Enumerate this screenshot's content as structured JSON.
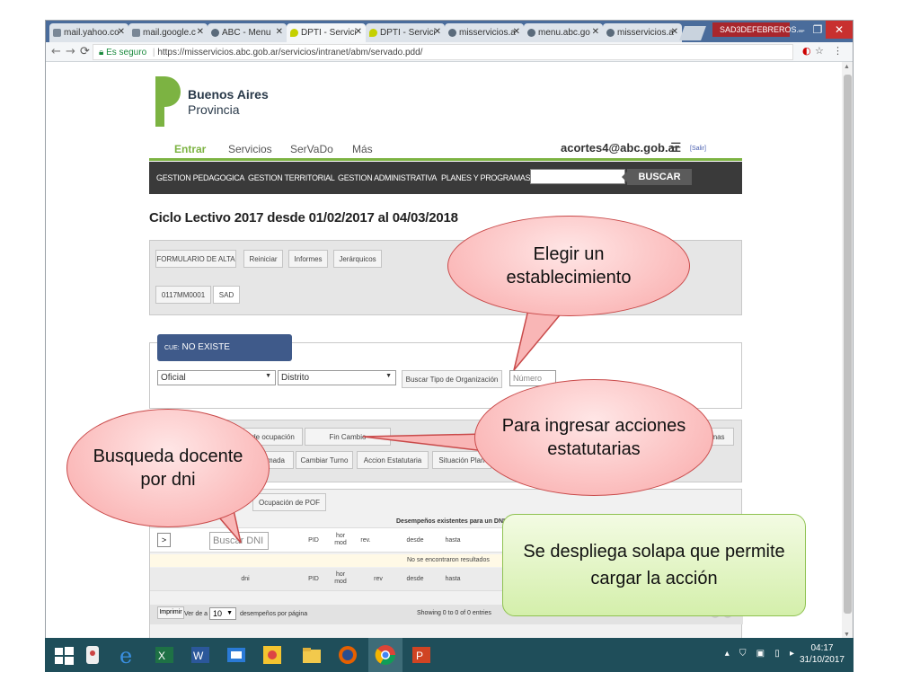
{
  "browser": {
    "tabs": [
      {
        "label": "mail.yahoo.co",
        "icon": "mail-icon"
      },
      {
        "label": "mail.google.c",
        "icon": "gmail-icon"
      },
      {
        "label": "ABC - Menu",
        "icon": "abc-icon"
      },
      {
        "label": "DPTI - Servici",
        "icon": "dpti-icon",
        "active": true
      },
      {
        "label": "DPTI - Servici",
        "icon": "dpti-icon"
      },
      {
        "label": "misservicios.a",
        "icon": "page-icon"
      },
      {
        "label": "menu.abc.go",
        "icon": "abc-icon"
      },
      {
        "label": "misservicios.a",
        "icon": "page-icon"
      }
    ],
    "profile_label": "SAD3DEFEBREROS...",
    "secure_label": "Es seguro",
    "url": "https://misservicios.abc.gob.ar/servicios/intranet/abm/servado.pdd/"
  },
  "site": {
    "logo_line1": "Buenos Aires",
    "logo_line2": "Provincia",
    "topnav": {
      "entrar": "Entrar",
      "servicios": "Servicios",
      "servado": "SerVaDo",
      "mas": "Más"
    },
    "user_email": "acortes4@abc.gob.ar",
    "salir": "[Salir]",
    "mainnav": [
      "GESTION PEDAGOGICA",
      "GESTION TERRITORIAL",
      "GESTION ADMINISTRATIVA",
      "PLANES Y PROGRAMAS"
    ],
    "buscar": "BUSCAR"
  },
  "page": {
    "title": "Ciclo Lectivo 2017 desde 01/02/2017 al 04/03/2018",
    "panel1_buttons": [
      "FORMULARIO DE ALTA",
      "Reiniciar",
      "Informes",
      "Jerárquicos"
    ],
    "panel1_row2": [
      "0117MM0001",
      "SAD"
    ],
    "cue_prefix": "CUE:",
    "cue_value": "NO EXISTE",
    "select_oficial": "Oficial",
    "select_distrito": "Distrito",
    "buscar_tipo": "Buscar Tipo de Organización",
    "numero_placeholder": "Número",
    "panel3_row1": [
      "de ocupación",
      "Fin Cambio"
    ],
    "panel3_row1_end": "mas",
    "panel3_row2": [
      "mada",
      "Cambiar Turno",
      "Accion Estatutaria",
      "Situación Plan"
    ],
    "ocupacion_pof": "Ocupación de POF",
    "table_title": "Desempeños existentes para un DNI",
    "expand_btn": ">",
    "dni_placeholder": "Buscar DNI",
    "search_row_headers": [
      "PID",
      "hor mod",
      "rev.",
      "desde",
      "hasta"
    ],
    "no_results": "No se encontraron resultados",
    "header_row2": [
      "dni",
      "PID",
      "hor mod",
      "rev",
      "desde",
      "hasta"
    ],
    "imprimir": "Imprimir",
    "ver_de_a": "Ver de a",
    "page_size": "10",
    "desempenos_por_pagina": "desempeños por página",
    "showing": "Showing 0 to 0 of 0 entries"
  },
  "annotations": {
    "elegir": "Elegir un establecimiento",
    "ingresar": "Para ingresar acciones estatutarias",
    "busqueda": "Busqueda docente por dni",
    "solapa": "Se despliega solapa que permite cargar la acción"
  },
  "taskbar": {
    "time": "04:17",
    "date": "31/10/2017"
  },
  "colors": {
    "accent_green": "#7cb342",
    "nav_dark": "#3a3a3a",
    "cue_blue": "#3f5a8a",
    "taskbar": "#1f4e5a",
    "bubble_red": "#f9a9a9",
    "callout_green": "#d4efab"
  }
}
